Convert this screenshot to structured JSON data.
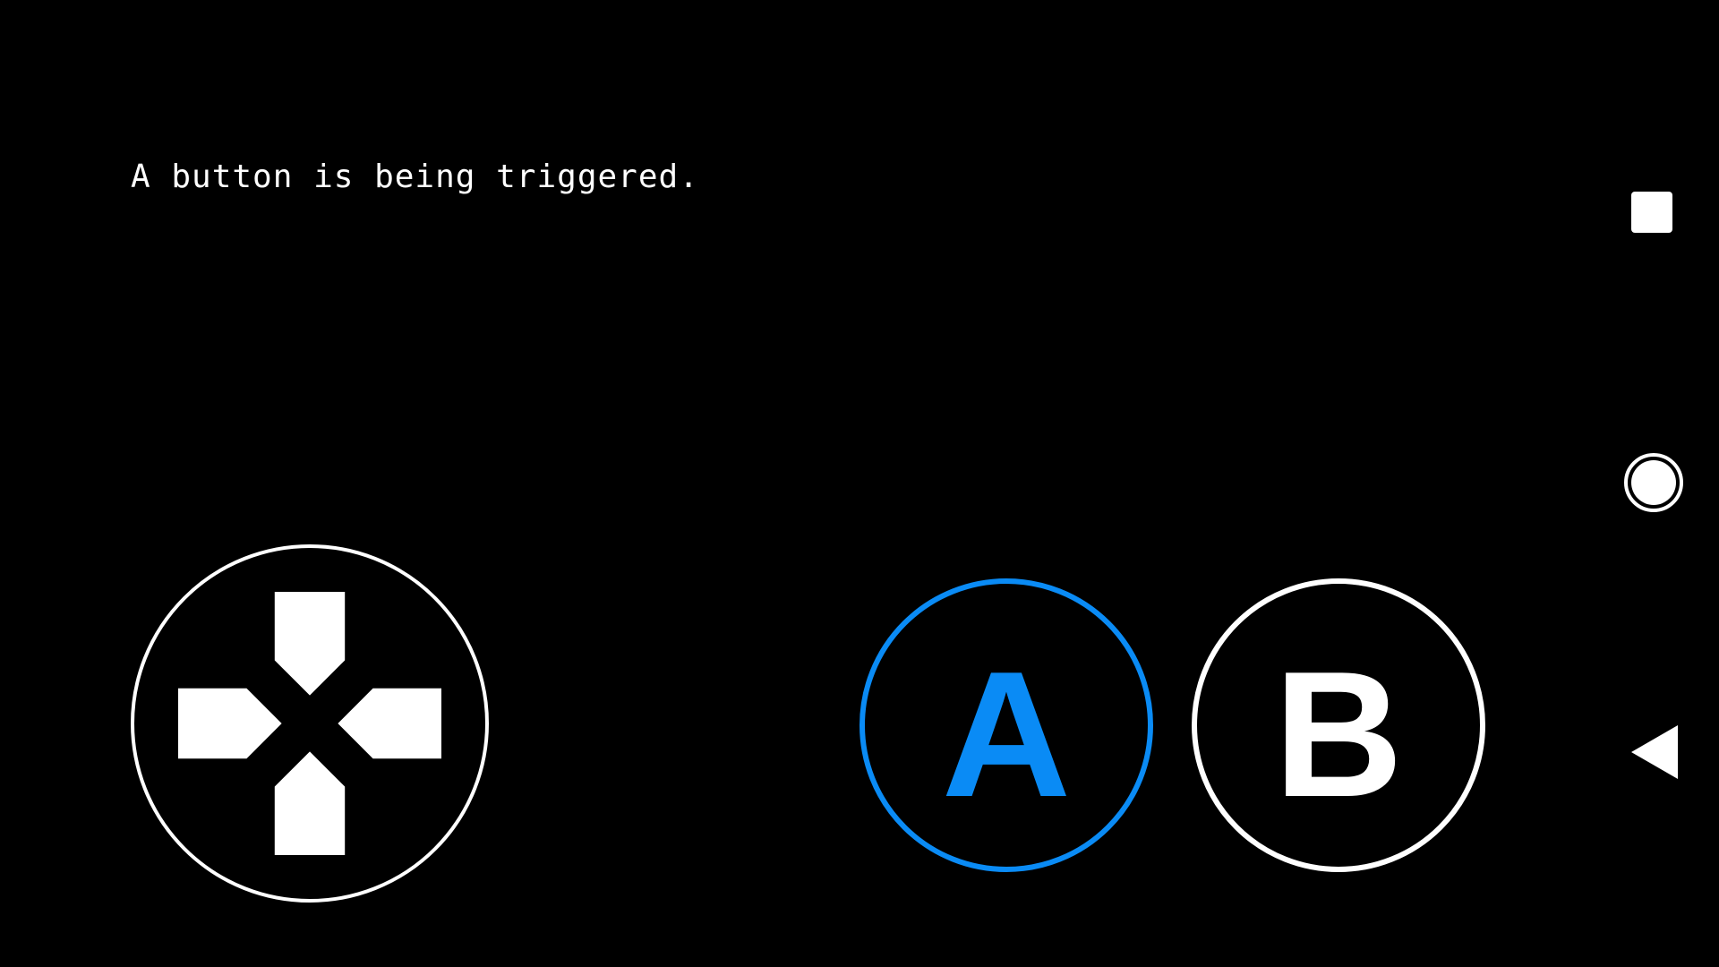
{
  "status": {
    "message": "A button is being triggered."
  },
  "controls": {
    "dpad": {
      "icon": "dpad-icon"
    },
    "button_a": {
      "label": "A",
      "color": "#0a8bf5",
      "state": "pressed"
    },
    "button_b": {
      "label": "B",
      "color": "#ffffff"
    }
  },
  "nav_bar": {
    "recents_icon": "square-icon",
    "home_icon": "circle-icon",
    "back_icon": "triangle-back-icon"
  }
}
